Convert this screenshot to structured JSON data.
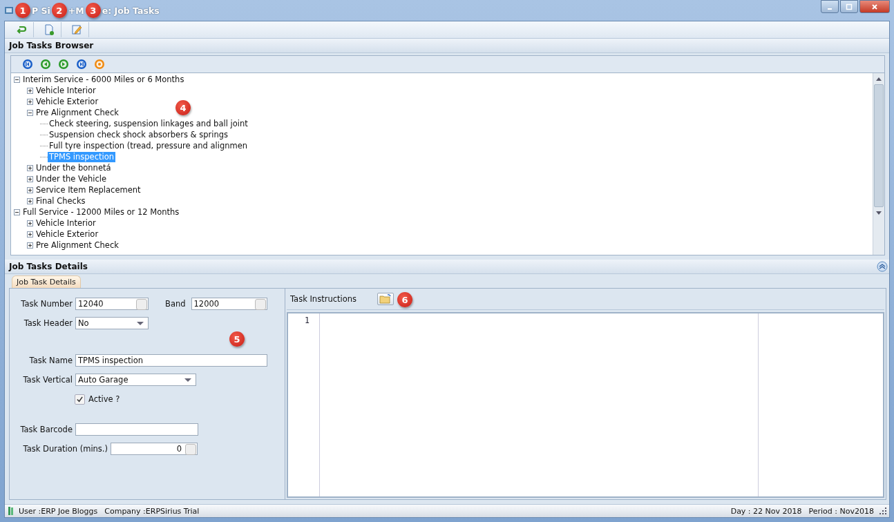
{
  "window": {
    "title_parts": [
      "P Si",
      "+M",
      "e: Job Tasks"
    ]
  },
  "callouts": [
    "1",
    "2",
    "3",
    "4",
    "5",
    "6"
  ],
  "browser": {
    "title": "Job Tasks Browser",
    "tree": [
      {
        "label": "Interim Service - 6000 Miles or 6 Months",
        "expanded": true,
        "selected": false,
        "children": [
          {
            "label": "Vehicle Interior",
            "expanded": false,
            "selected": false
          },
          {
            "label": "Vehicle Exterior",
            "expanded": false,
            "selected": false
          },
          {
            "label": "Pre Alignment Check",
            "expanded": true,
            "selected": false,
            "children": [
              {
                "label": "Check steering, suspension linkages and ball joint",
                "selected": false
              },
              {
                "label": "Suspension check shock absorbers & springs",
                "selected": false
              },
              {
                "label": "Full tyre inspection (tread, pressure and alignmen",
                "selected": false
              },
              {
                "label": "TPMS inspection",
                "selected": true
              }
            ]
          },
          {
            "label": "Under the bonnetá",
            "expanded": false,
            "selected": false
          },
          {
            "label": "Under the Vehicle",
            "expanded": false,
            "selected": false
          },
          {
            "label": "Service Item Replacement",
            "expanded": false,
            "selected": false
          },
          {
            "label": "Final Checks",
            "expanded": false,
            "selected": false
          }
        ]
      },
      {
        "label": "Full Service - 12000 Miles or 12 Months",
        "expanded": true,
        "selected": false,
        "children": [
          {
            "label": "Vehicle Interior",
            "expanded": false,
            "selected": false
          },
          {
            "label": "Vehicle Exterior",
            "expanded": false,
            "selected": false
          },
          {
            "label": "Pre Alignment Check",
            "expanded": false,
            "selected": false
          }
        ]
      }
    ]
  },
  "details": {
    "title": "Job Tasks Details",
    "tab": "Job Task Details",
    "task_number": {
      "label": "Task Number",
      "value": "12040"
    },
    "band": {
      "label": "Band",
      "value": "12000"
    },
    "task_header": {
      "label": "Task Header",
      "value": "No"
    },
    "task_name": {
      "label": "Task Name",
      "value": "TPMS inspection"
    },
    "task_vertical": {
      "label": "Task Vertical",
      "value": "Auto Garage"
    },
    "active": {
      "label": "Active ?",
      "checked": true
    },
    "task_barcode": {
      "label": "Task Barcode"
    },
    "task_duration": {
      "label": "Task Duration (mins.)",
      "value": "0"
    },
    "instructions": {
      "label": "Task Instructions",
      "line_numbers": [
        "1"
      ]
    }
  },
  "status_bar": {
    "user": "User :ERP Joe Bloggs",
    "company": "Company :ERPSirius Trial",
    "day": "Day : 22 Nov 2018",
    "period": "Period : Nov2018"
  }
}
